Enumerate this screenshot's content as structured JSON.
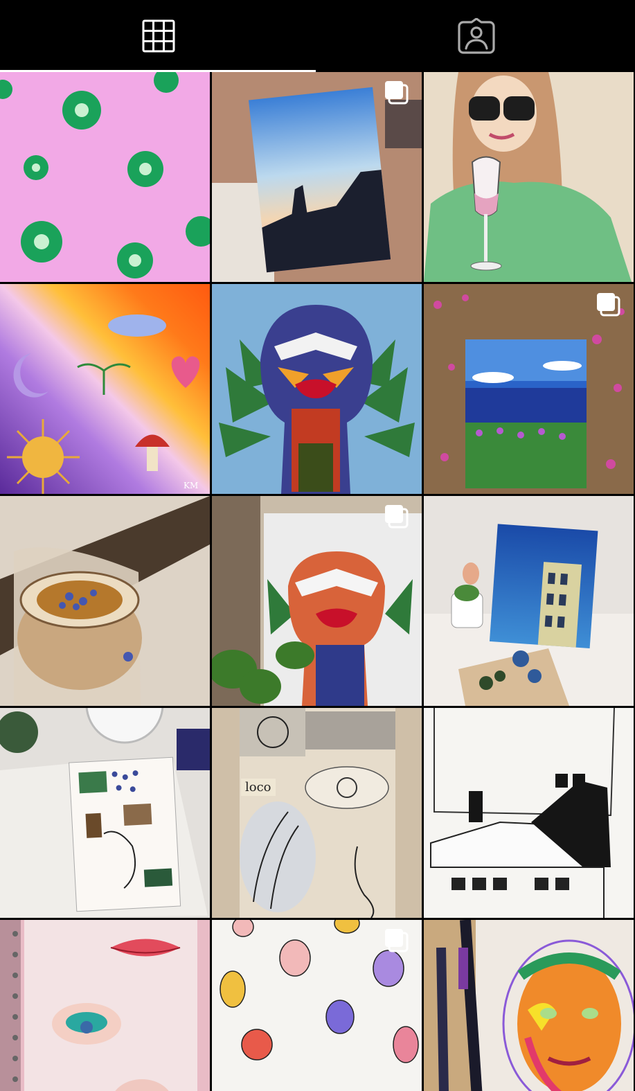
{
  "tabs": [
    {
      "name": "grid",
      "icon": "grid-icon",
      "selected": true
    },
    {
      "name": "tagged",
      "icon": "tagged-person-icon",
      "selected": false
    }
  ],
  "posts": [
    {
      "id": 1,
      "subject": "green-flowers-on-pink",
      "multiple": false
    },
    {
      "id": 2,
      "subject": "sunset-silhouette-canvas",
      "multiple": true
    },
    {
      "id": 3,
      "subject": "woman-with-wine-glass",
      "multiple": false
    },
    {
      "id": 4,
      "subject": "psychedelic-sun-moon-heart-mushroom",
      "multiple": false,
      "signature": "KM"
    },
    {
      "id": 5,
      "subject": "colorful-face-with-leaves",
      "multiple": false
    },
    {
      "id": 6,
      "subject": "ocean-cliff-flowers-canvas",
      "multiple": true
    },
    {
      "id": 7,
      "subject": "tea-cup-painting",
      "multiple": false
    },
    {
      "id": 8,
      "subject": "colorful-face-canvas-with-plants",
      "multiple": true
    },
    {
      "id": 9,
      "subject": "tower-canvas-with-palette",
      "multiple": false
    },
    {
      "id": 10,
      "subject": "sketchbook-collage",
      "multiple": false
    },
    {
      "id": 11,
      "subject": "loco-collage",
      "multiple": false,
      "text": "loco"
    },
    {
      "id": 12,
      "subject": "rooftops-ink-drawing",
      "multiple": false
    },
    {
      "id": 13,
      "subject": "lips-and-eyes-makeup",
      "multiple": false
    },
    {
      "id": 14,
      "subject": "line-faces-dots",
      "multiple": true
    },
    {
      "id": 15,
      "subject": "neon-portrait-with-pens",
      "multiple": false
    }
  ],
  "colors": {
    "background": "#000000",
    "indicator": "#ffffff"
  }
}
